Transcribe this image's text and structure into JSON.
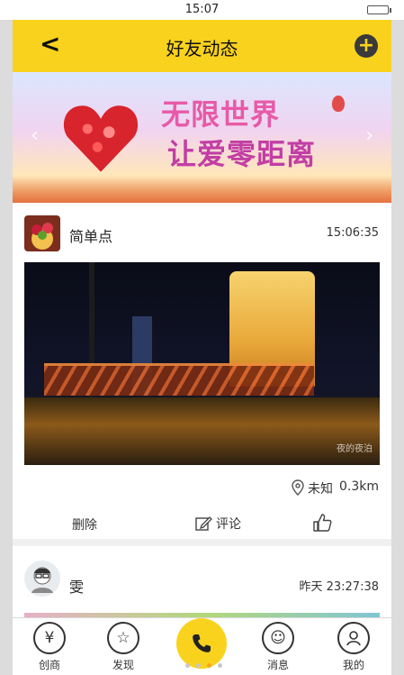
{
  "status_bar": {
    "time": "15:07"
  },
  "header": {
    "title": "好友动态",
    "back_icon": "back-chevron-icon",
    "add_icon": "plus-circle-icon"
  },
  "banner": {
    "line1": "无限世界",
    "line2": "让爱零距离",
    "prev": "‹",
    "next": "›"
  },
  "posts": [
    {
      "username": "简单点",
      "time": "15:06:35",
      "watermark": "夜的夜泊",
      "location": "未知",
      "distance": "0.3km",
      "actions": {
        "delete": "删除",
        "comment": "评论"
      }
    },
    {
      "username": "雯",
      "time": "昨天 23:27:38"
    }
  ],
  "tabbar": {
    "items": [
      {
        "label": "创商",
        "glyph": "¥"
      },
      {
        "label": "发现",
        "glyph": "☆"
      },
      {
        "label": "消息",
        "glyph": "☺"
      },
      {
        "label": "我的",
        "glyph": ""
      }
    ],
    "call_icon": "phone-icon",
    "page_indicator": {
      "count": 4,
      "active": 2
    }
  },
  "colors": {
    "accent": "#f9d21d",
    "text": "#222222",
    "separator": "#f0f0f0"
  }
}
